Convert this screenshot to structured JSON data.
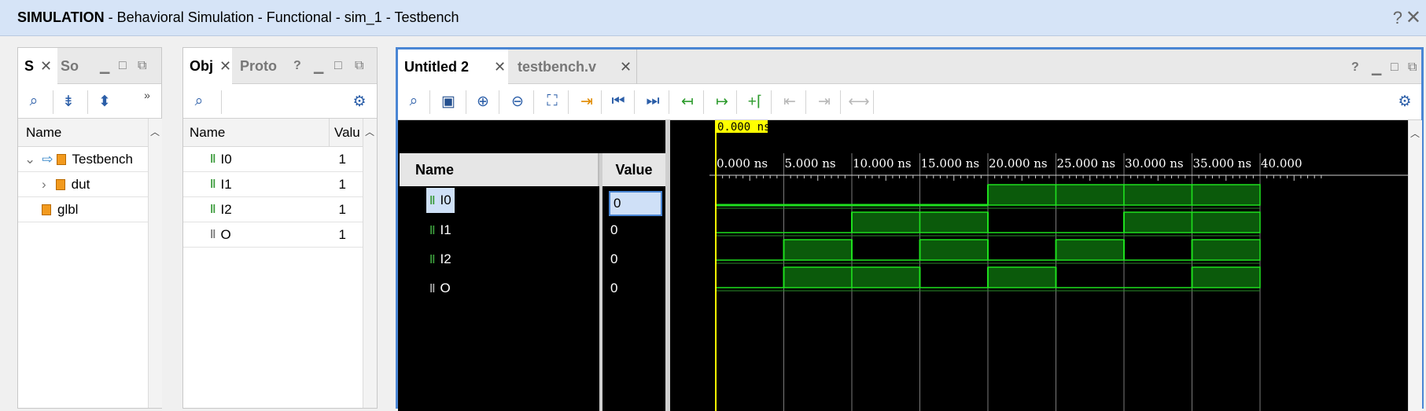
{
  "title": {
    "bold": "SIMULATION",
    "rest": " - Behavioral Simulation - Functional - sim_1 - Testbench",
    "help": "?",
    "close": "✕"
  },
  "scopes_panel": {
    "tab_active": "S",
    "tab_inactive": "So",
    "column": "Name",
    "rows": [
      {
        "label": "Testbench",
        "indent": 0
      },
      {
        "label": "dut",
        "indent": 1
      },
      {
        "label": "glbl",
        "indent": 0
      }
    ]
  },
  "objects_panel": {
    "tab_active": "Obj",
    "tab_inactive": "Proto",
    "help": "?",
    "col_name": "Name",
    "col_value": "Valu",
    "rows": [
      {
        "name": "I0",
        "value": "1"
      },
      {
        "name": "I1",
        "value": "1"
      },
      {
        "name": "I2",
        "value": "1"
      },
      {
        "name": "O",
        "value": "1"
      }
    ]
  },
  "wave_panel": {
    "tab_active": "Untitled 2",
    "tab_inactive": "testbench.v",
    "help": "?",
    "col_name": "Name",
    "col_value": "Value",
    "cursor_time": "0.000 ns",
    "time_labels": [
      "0.000 ns",
      "5.000 ns",
      "10.000 ns",
      "15.000 ns",
      "20.000 ns",
      "25.000 ns",
      "30.000 ns",
      "35.000 ns",
      "40.000"
    ],
    "signals": [
      {
        "name": "I0",
        "value": "0",
        "wave": [
          0,
          0,
          0,
          0,
          1,
          1,
          1,
          1
        ]
      },
      {
        "name": "I1",
        "value": "0",
        "wave": [
          0,
          0,
          1,
          1,
          0,
          0,
          1,
          1
        ]
      },
      {
        "name": "I2",
        "value": "0",
        "wave": [
          0,
          1,
          0,
          1,
          0,
          1,
          0,
          1
        ]
      },
      {
        "name": "O",
        "value": "0",
        "wave": [
          0,
          1,
          1,
          0,
          1,
          0,
          0,
          1
        ]
      }
    ],
    "colors": {
      "wave_line": "#1ee01e",
      "wave_fill": "#0b5a0b",
      "cursor": "#ffff00",
      "background": "#000000"
    }
  }
}
